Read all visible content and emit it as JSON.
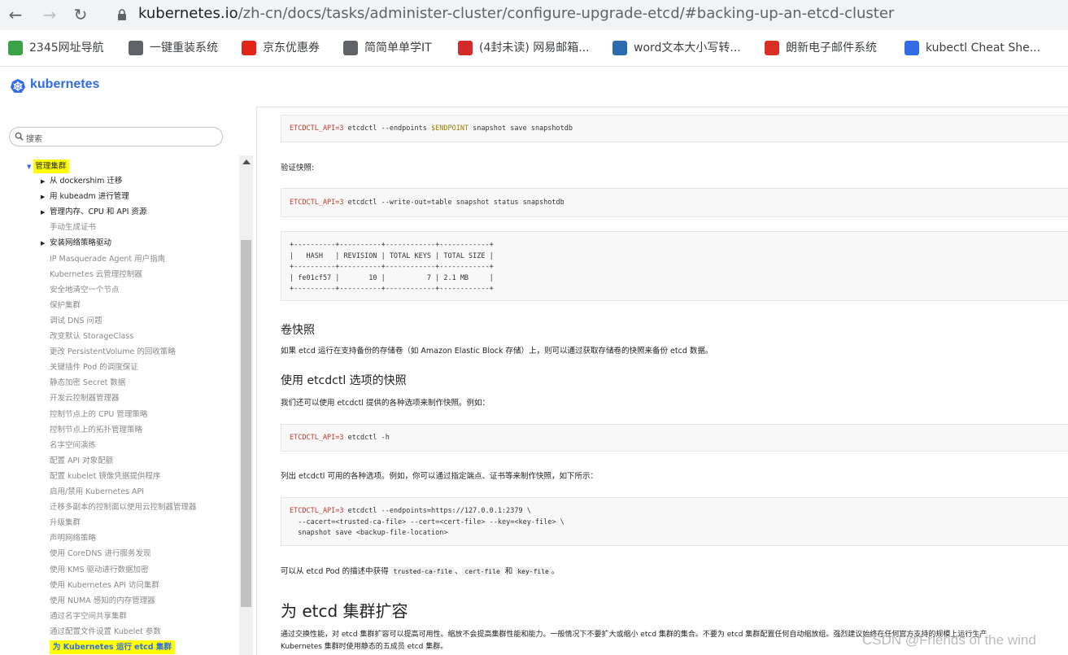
{
  "browser": {
    "url_host": "kubernetes.io",
    "url_path": "/zh-cn/docs/tasks/administer-cluster/configure-upgrade-etcd/#backing-up-an-etcd-cluster",
    "bookmarks": [
      {
        "label": "2345网址导航",
        "icon": "2345-icon",
        "color": "#3aa34a"
      },
      {
        "label": "一键重装系统",
        "icon": "globe-icon",
        "color": "#5f6368"
      },
      {
        "label": "京东优惠券",
        "icon": "jd-icon",
        "color": "#e1251b"
      },
      {
        "label": "简简单单学IT",
        "icon": "globe-icon",
        "color": "#5f6368"
      },
      {
        "label": "(4封未读) 网易邮箱...",
        "icon": "netease-icon",
        "color": "#d42a2a"
      },
      {
        "label": "word文本大小写转...",
        "icon": "xue-icon",
        "color": "#2b6cb0"
      },
      {
        "label": "朗新电子邮件系统",
        "icon": "gmail-icon",
        "color": "#d93025"
      },
      {
        "label": "kubectl Cheat She...",
        "icon": "k8s-icon",
        "color": "#326ce5"
      }
    ]
  },
  "header": {
    "brand": "kubernetes"
  },
  "sidebar": {
    "search_placeholder": "搜索",
    "root_label": "管理集群",
    "items": [
      {
        "label": "从 dockershim 迁移",
        "arrow": true
      },
      {
        "label": "用 kubeadm 进行管理",
        "arrow": true
      },
      {
        "label": "管理内存、CPU 和 API 资源",
        "arrow": true
      },
      {
        "label": "手动生成证书",
        "arrow": false
      },
      {
        "label": "安装网络策略驱动",
        "arrow": true
      },
      {
        "label": "IP Masquerade Agent 用户指南",
        "arrow": false
      },
      {
        "label": "Kubernetes 云管理控制器",
        "arrow": false
      },
      {
        "label": "安全地清空一个节点",
        "arrow": false
      },
      {
        "label": "保护集群",
        "arrow": false
      },
      {
        "label": "调试 DNS 问题",
        "arrow": false
      },
      {
        "label": "改变默认 StorageClass",
        "arrow": false
      },
      {
        "label": "更改 PersistentVolume 的回收策略",
        "arrow": false
      },
      {
        "label": "关键插件 Pod 的调度保证",
        "arrow": false
      },
      {
        "label": "静态加密 Secret 数据",
        "arrow": false
      },
      {
        "label": "开发云控制器管理器",
        "arrow": false
      },
      {
        "label": "控制节点上的 CPU 管理策略",
        "arrow": false
      },
      {
        "label": "控制节点上的拓扑管理策略",
        "arrow": false
      },
      {
        "label": "名字空间演练",
        "arrow": false
      },
      {
        "label": "配置 API 对象配额",
        "arrow": false
      },
      {
        "label": "配置 kubelet 镜像凭据提供程序",
        "arrow": false
      },
      {
        "label": "启用/禁用 Kubernetes API",
        "arrow": false
      },
      {
        "label": "迁移多副本的控制面以使用云控制器管理器",
        "arrow": false
      },
      {
        "label": "升级集群",
        "arrow": false
      },
      {
        "label": "声明网络策略",
        "arrow": false
      },
      {
        "label": "使用 CoreDNS 进行服务发现",
        "arrow": false
      },
      {
        "label": "使用 KMS 驱动进行数据加密",
        "arrow": false
      },
      {
        "label": "使用 Kubernetes API 访问集群",
        "arrow": false
      },
      {
        "label": "使用 NUMA 感知的内存管理器",
        "arrow": false
      },
      {
        "label": "通过名字空间共享集群",
        "arrow": false
      },
      {
        "label": "通过配置文件设置 Kubelet 参数",
        "arrow": false
      },
      {
        "label": "为 Kubernetes 运行 etcd 集群",
        "arrow": false,
        "active": true
      }
    ]
  },
  "content": {
    "code1": {
      "env": "ETCDCTL_API=3",
      "mid": " etcdctl --endpoints ",
      "var": "$ENDPOINT",
      "rest": " snapshot save snapshotdb"
    },
    "verify_label": "验证快照:",
    "code2": {
      "env": "ETCDCTL_API=3",
      "rest": " etcdctl --write-out=table snapshot status snapshotdb"
    },
    "table_output": "+----------+----------+------------+------------+\n|   HASH   | REVISION | TOTAL KEYS | TOTAL SIZE |\n+----------+----------+------------+------------+\n| fe01cf57 |       10 |          7 | 2.1 MB     |\n+----------+----------+------------+------------+",
    "h_volume": "卷快照",
    "p_volume": "如果 etcd 运行在支持备份的存储卷（如 Amazon Elastic Block 存储）上，则可以通过获取存储卷的快照来备份 etcd 数据。",
    "h_options": "使用 etcdctl 选项的快照",
    "p_options": "我们还可以使用 etcdctl 提供的各种选项来制作快照。例如：",
    "code3": {
      "env": "ETCDCTL_API=3",
      "rest": " etcdctl -h"
    },
    "p_list": "列出 etcdctl 可用的各种选项。例如，你可以通过指定端点、证书等来制作快照，如下所示：",
    "code4": {
      "env": "ETCDCTL_API=3",
      "rest": " etcdctl --endpoints=https://127.0.0.1:2379 \\\n  --cacert=<trusted-ca-file> --cert=<cert-file> --key=<key-file> \\\n  snapshot save <backup-file-location>"
    },
    "p_obtain_pre": "可以从 etcd Pod 的描述中获得 ",
    "code_trusted": "trusted-ca-file",
    "sep1": "、",
    "code_cert": "cert-file",
    "sep2": " 和 ",
    "code_key": "key-file",
    "p_obtain_post": "。",
    "h_scale": "为 etcd 集群扩容",
    "p_scale_1": "通过交换性能，对 etcd 集群扩容可以提高可用性。缩放不会提高集群性能和能力。一般情况下不要扩大或缩小 etcd 集群的集合。不要为 etcd 集群配置任何自动缩放组。强烈建议始终在任何官方支持的规模上运行生产",
    "p_scale_2": "Kubernetes 集群时使用静态的五成员 etcd 集群。"
  },
  "watermark": "CSDN @Friends of the wind"
}
